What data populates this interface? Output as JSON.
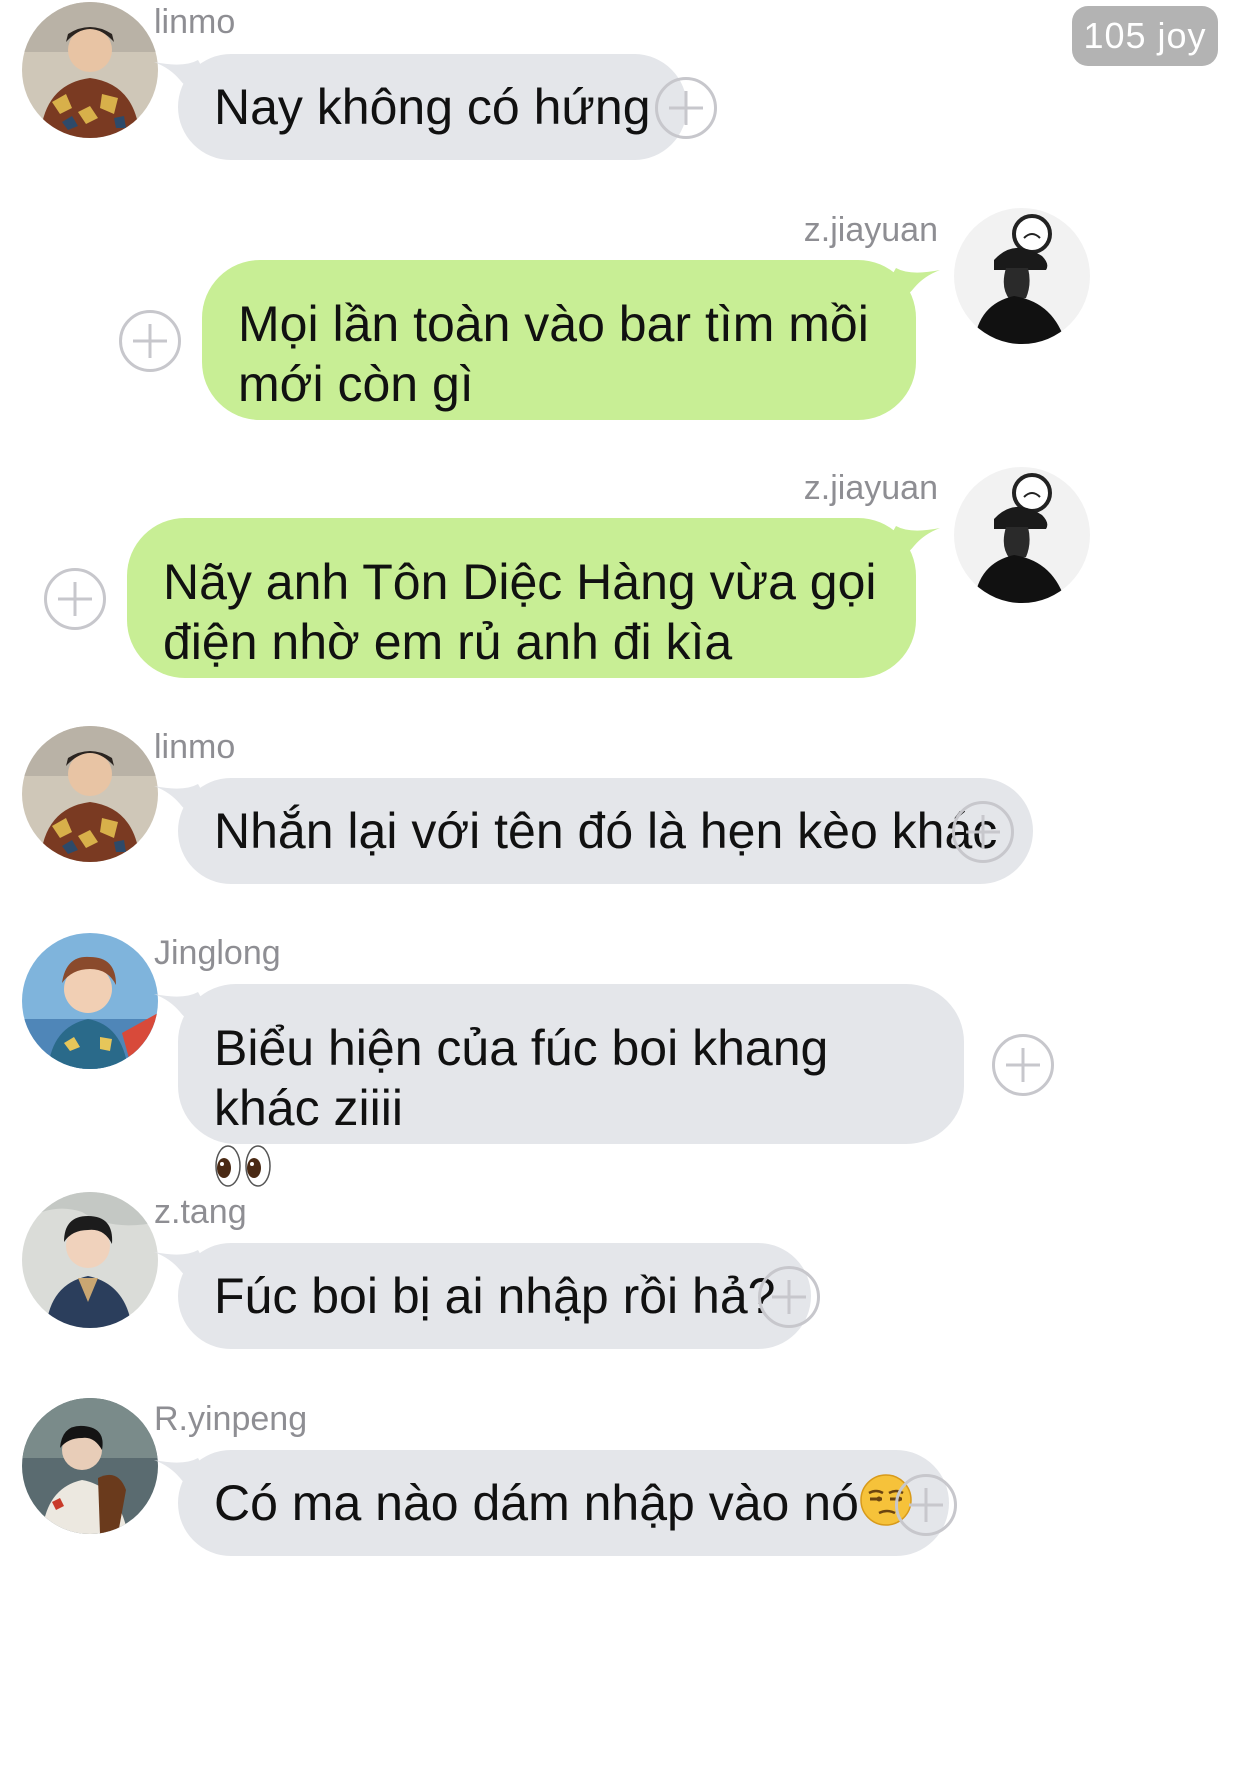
{
  "header": {
    "joy_badge": "105 joy"
  },
  "messages": [
    {
      "sender": "linmo",
      "side": "left",
      "text": "Nay không có hứng"
    },
    {
      "sender": "z.jiayuan",
      "side": "right",
      "text": "Mọi lần toàn vào bar tìm mồi mới còn gì"
    },
    {
      "sender": "z.jiayuan",
      "side": "right",
      "text": "Nãy anh Tôn Diệc Hàng vừa gọi điện nhờ em rủ anh đi kìa"
    },
    {
      "sender": "linmo",
      "side": "left",
      "text": "Nhắn lại với tên đó là hẹn kèo khác"
    },
    {
      "sender": "Jinglong",
      "side": "left",
      "text": "Biểu hiện của fúc boi khang khác ziiii",
      "emoji": "eyes-emoji"
    },
    {
      "sender": "z.tang",
      "side": "left",
      "text": "Fúc boi bị ai nhập rồi hả?"
    },
    {
      "sender": "R.yinpeng",
      "side": "left",
      "text": "Có ma nào dám nhập vào nó",
      "emoji": "unamused-face-emoji"
    }
  ],
  "colors": {
    "incoming_bubble": "#e4e6ea",
    "outgoing_bubble": "#c8ee95",
    "sender_name": "#8e8e93",
    "badge_bg": "#b3b3b3",
    "add_reaction_icon": "#c7c7cc"
  },
  "icons": {
    "add_reaction": "plus-circle-icon"
  }
}
